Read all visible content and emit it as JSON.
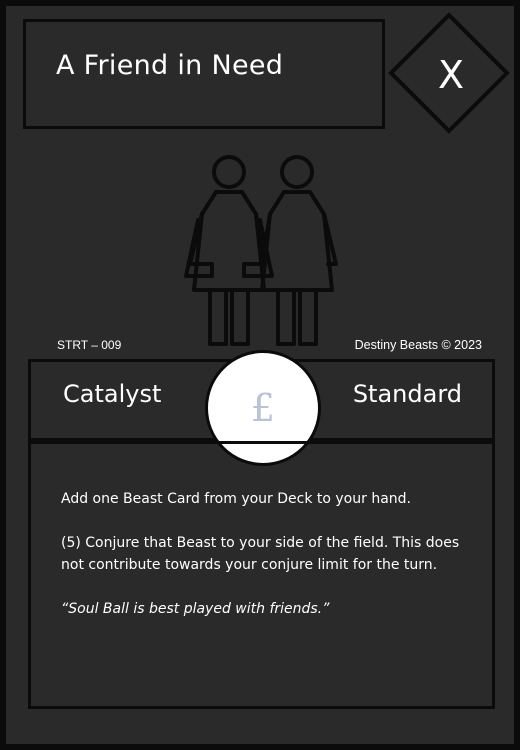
{
  "card": {
    "title": "A Friend in Need",
    "element_symbol": "X",
    "art_icon": "two-women-icon",
    "set_code": "STRT – 009",
    "copyright": "Destiny Beasts © 2023",
    "type": "Catalyst",
    "rarity": "Standard",
    "cost_symbol": "£",
    "effects": [
      "Add one Beast Card from your Deck to your hand.",
      "(5) Conjure that Beast to your side of the field. This does not contribute towards your conjure limit for the turn."
    ],
    "flavor_text": "“Soul Ball is best played with friends.”"
  },
  "colors": {
    "card_background": "#2a2a2a",
    "border": "#0b0b0b",
    "text": "#ffffff",
    "cost_circle": "#ffffff",
    "cost_symbol": "#b9c3d4"
  }
}
